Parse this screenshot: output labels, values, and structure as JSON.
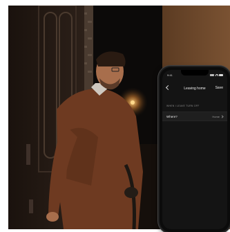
{
  "phone": {
    "status_time": "9:41",
    "nav_title": "Leaving home",
    "save_label": "Save",
    "section_label": "WHEN I LEAVE TURN OFF",
    "row_label": "Where?",
    "row_value": "Home"
  },
  "colors": {
    "screen_bg": "#141414",
    "row_bg": "#1f1f1f",
    "scene_warm": "#3a2718"
  },
  "icons": [
    "back-chevron-icon",
    "signal-icon",
    "wifi-icon",
    "battery-icon",
    "chevron-right-icon"
  ]
}
